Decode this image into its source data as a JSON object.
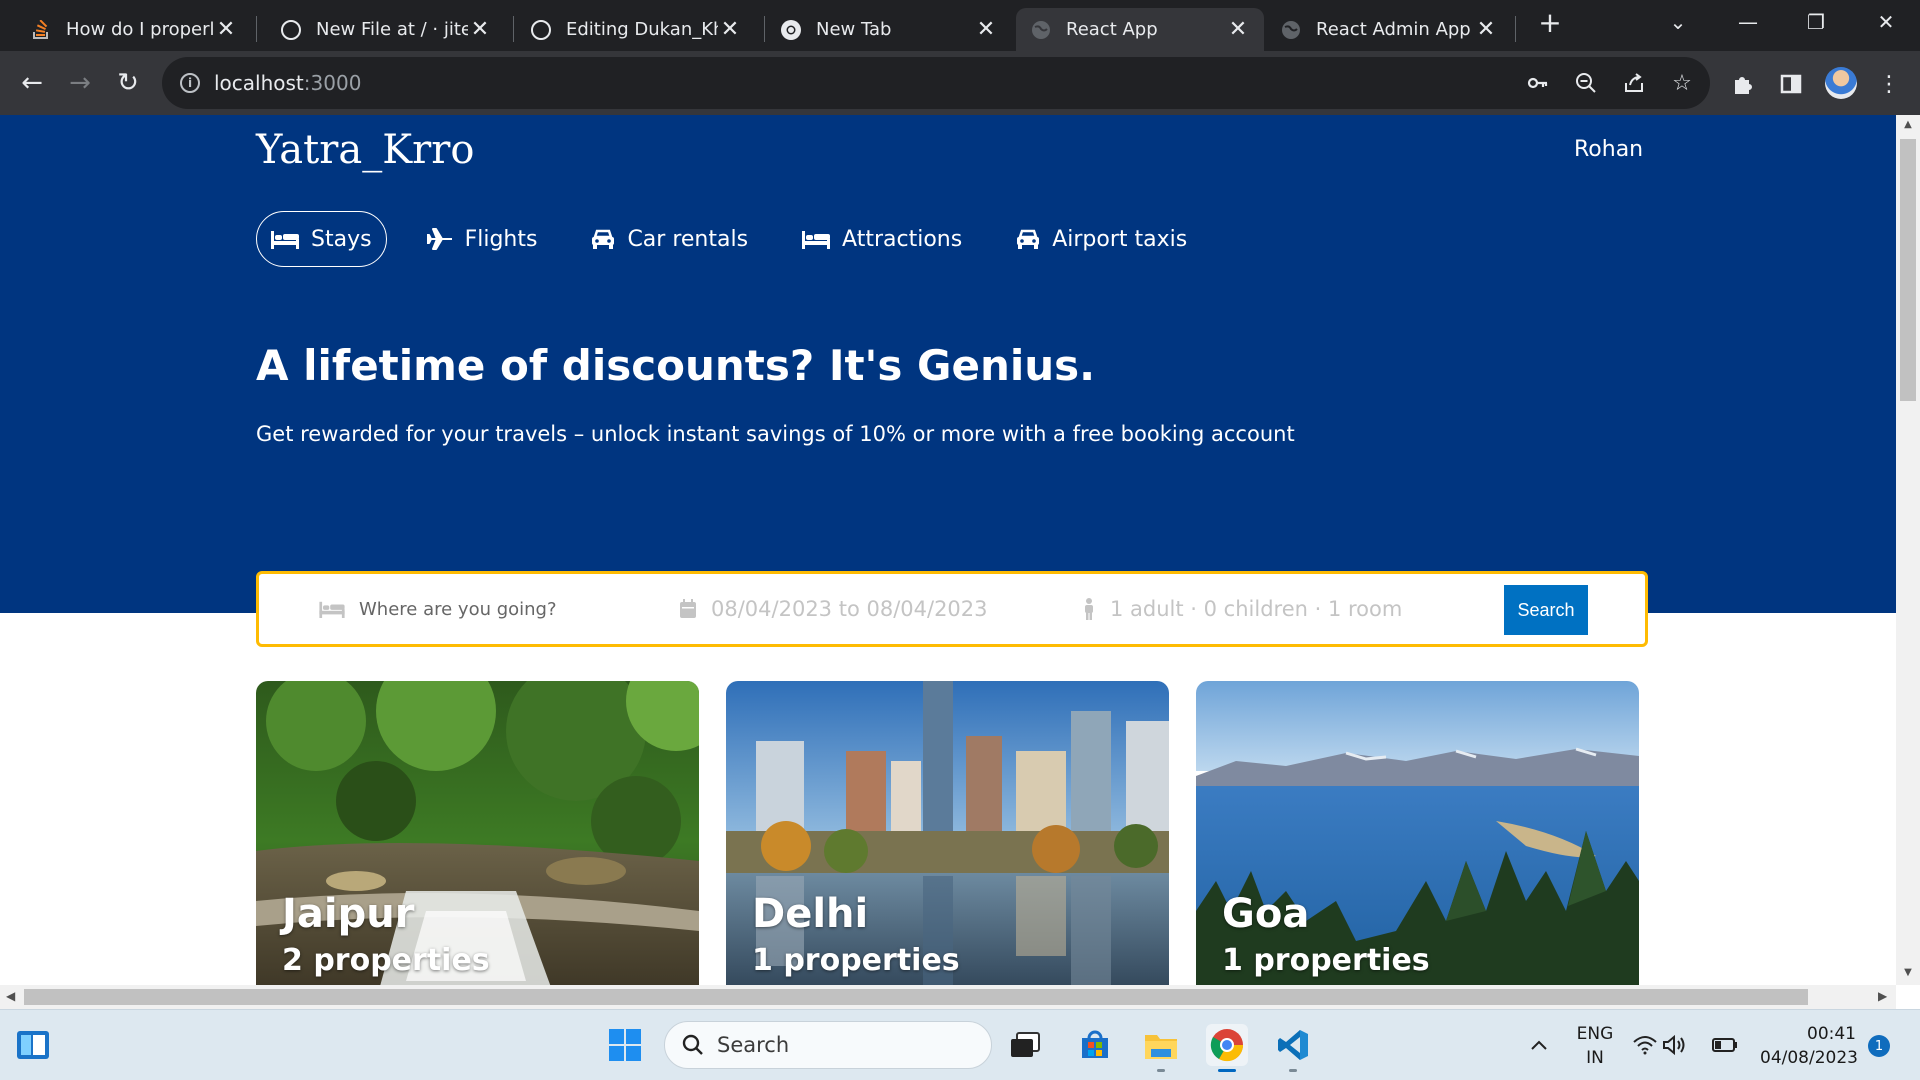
{
  "browser": {
    "tabs": [
      {
        "title": "How do I properly f",
        "icon": "stackoverflow-icon"
      },
      {
        "title": "New File at / · jitend",
        "icon": "github-icon"
      },
      {
        "title": "Editing Dukan_Khat",
        "icon": "github-icon"
      },
      {
        "title": "New Tab",
        "icon": "chrome-icon"
      },
      {
        "title": "React App",
        "icon": "globe-icon",
        "active": true
      },
      {
        "title": "React Admin App",
        "icon": "globe-icon"
      }
    ],
    "url_host": "localhost",
    "url_port": ":3000"
  },
  "site": {
    "brand": "Yatra_Krro",
    "user": "Rohan",
    "nav": [
      {
        "label": "Stays",
        "icon": "bed-icon",
        "active": true
      },
      {
        "label": "Flights",
        "icon": "plane-icon"
      },
      {
        "label": "Car rentals",
        "icon": "car-icon"
      },
      {
        "label": "Attractions",
        "icon": "bed-icon"
      },
      {
        "label": "Airport taxis",
        "icon": "taxi-icon"
      }
    ],
    "headline": "A lifetime of discounts? It's Genius.",
    "subline": "Get rewarded for your travels – unlock instant savings of 10% or more with a free booking account",
    "search": {
      "destination_placeholder": "Where are you going?",
      "dates": "08/04/2023 to 08/04/2023",
      "options": "1 adult · 0 children · 1 room",
      "button": "Search"
    },
    "featured": [
      {
        "city": "Jaipur",
        "properties": "2 properties"
      },
      {
        "city": "Delhi",
        "properties": "1 properties"
      },
      {
        "city": "Goa",
        "properties": "1 properties"
      }
    ],
    "colors": {
      "hero": "#003580",
      "search_border": "#febb02",
      "button": "#0071c2"
    }
  },
  "taskbar": {
    "search_label": "Search",
    "lang_top": "ENG",
    "lang_bottom": "IN",
    "time": "00:41",
    "date": "04/08/2023",
    "notifications": "1"
  }
}
